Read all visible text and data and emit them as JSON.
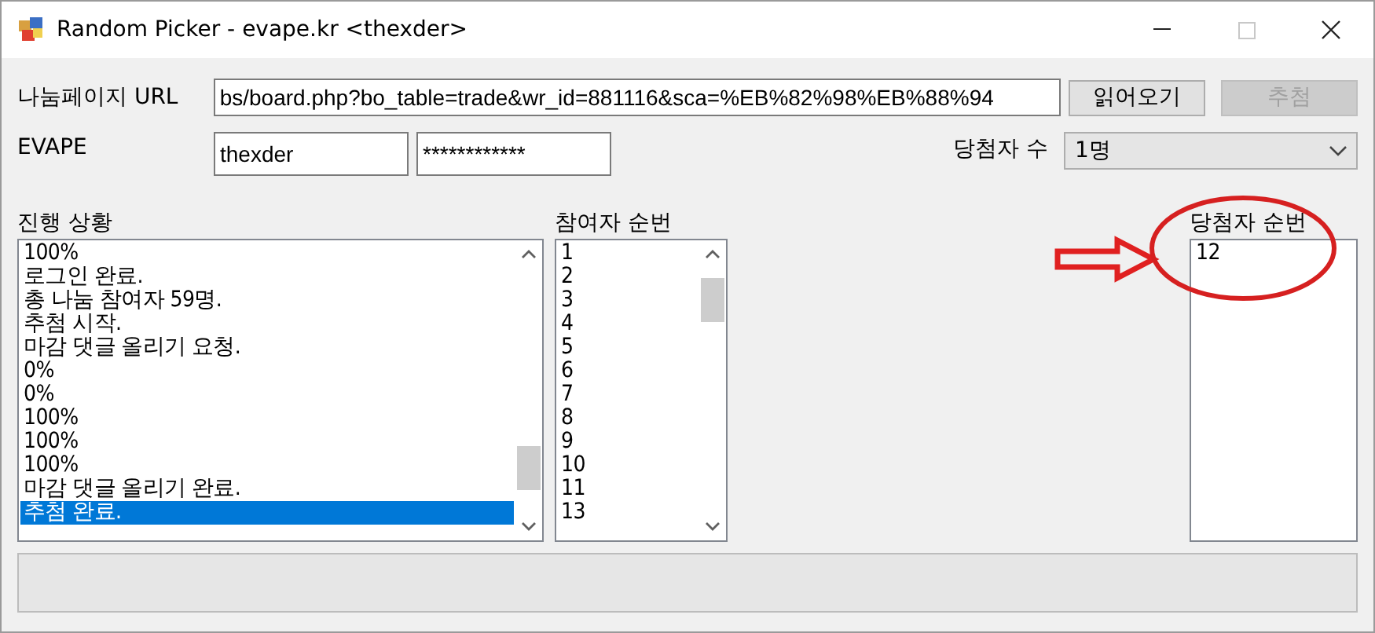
{
  "window": {
    "title": "Random Picker - evape.kr <thexder>",
    "controls": [
      {
        "kind": "minimize",
        "disabled": false
      },
      {
        "kind": "maximize",
        "disabled": true
      },
      {
        "kind": "close",
        "disabled": false
      }
    ]
  },
  "url_row": {
    "label": "나눔페이지 URL",
    "value": "bs/board.php?bo_table=trade&wr_id=881116&sca=%EB%82%98%EB%88%94",
    "buttons": [
      {
        "label": "읽어오기",
        "disabled": false
      },
      {
        "label": "추첨",
        "disabled": true
      }
    ]
  },
  "account_row": {
    "label": "EVAPE",
    "user": "thexder",
    "password": "************"
  },
  "winner_count": {
    "label": "당첨자 수",
    "value": "1명"
  },
  "log": {
    "label": "진행 상황",
    "items": [
      {
        "text": "100%",
        "selected": false
      },
      {
        "text": "로그인 완료.",
        "selected": false
      },
      {
        "text": "총 나눔 참여자 59명.",
        "selected": false
      },
      {
        "text": "추첨 시작.",
        "selected": false
      },
      {
        "text": "마감 댓글 올리기 요청.",
        "selected": false
      },
      {
        "text": "0%",
        "selected": false
      },
      {
        "text": "0%",
        "selected": false
      },
      {
        "text": "100%",
        "selected": false
      },
      {
        "text": "100%",
        "selected": false
      },
      {
        "text": "100%",
        "selected": false
      },
      {
        "text": "마감 댓글 올리기 완료.",
        "selected": false
      },
      {
        "text": "추첨 완료.",
        "selected": true
      }
    ]
  },
  "participants": {
    "label": "참여자 순번",
    "items": [
      {
        "text": "1",
        "selected": false
      },
      {
        "text": "2",
        "selected": false
      },
      {
        "text": "3",
        "selected": false
      },
      {
        "text": "4",
        "selected": false
      },
      {
        "text": "5",
        "selected": false
      },
      {
        "text": "6",
        "selected": false
      },
      {
        "text": "7",
        "selected": false
      },
      {
        "text": "8",
        "selected": false
      },
      {
        "text": "9",
        "selected": false
      },
      {
        "text": "10",
        "selected": false
      },
      {
        "text": "11",
        "selected": false
      },
      {
        "text": "13",
        "selected": false
      }
    ]
  },
  "winners": {
    "label": "당첨자 순번",
    "items": [
      {
        "text": "12",
        "selected": false
      }
    ]
  },
  "progress": {
    "level": 0
  }
}
